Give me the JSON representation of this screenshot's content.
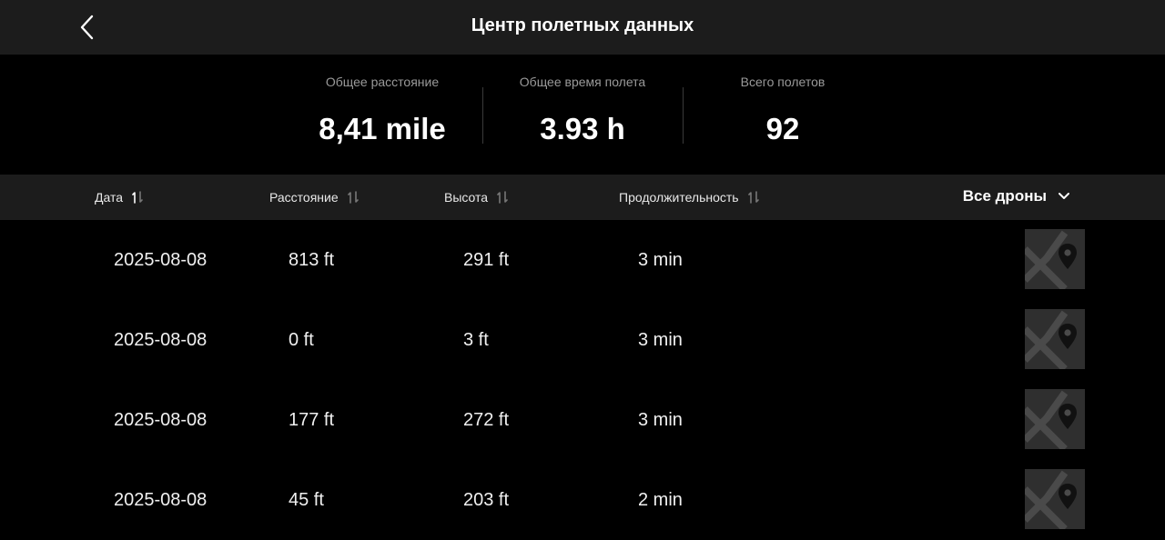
{
  "header": {
    "title": "Центр полетных данных"
  },
  "stats": [
    {
      "label": "Общее расстояние",
      "value": "8,41 mile"
    },
    {
      "label": "Общее время полета",
      "value": "3.93 h"
    },
    {
      "label": "Всего полетов",
      "value": "92"
    }
  ],
  "columns": {
    "date": "Дата",
    "distance": "Расстояние",
    "altitude": "Высота",
    "duration": "Продолжительность"
  },
  "drone_filter": "Все дроны",
  "flights": [
    {
      "date": "2025-08-08",
      "distance": "813 ft",
      "altitude": "291 ft",
      "duration": "3 min"
    },
    {
      "date": "2025-08-08",
      "distance": "0 ft",
      "altitude": "3 ft",
      "duration": "3 min"
    },
    {
      "date": "2025-08-08",
      "distance": "177 ft",
      "altitude": "272 ft",
      "duration": "3 min"
    },
    {
      "date": "2025-08-08",
      "distance": "45 ft",
      "altitude": "203 ft",
      "duration": "2 min"
    }
  ]
}
